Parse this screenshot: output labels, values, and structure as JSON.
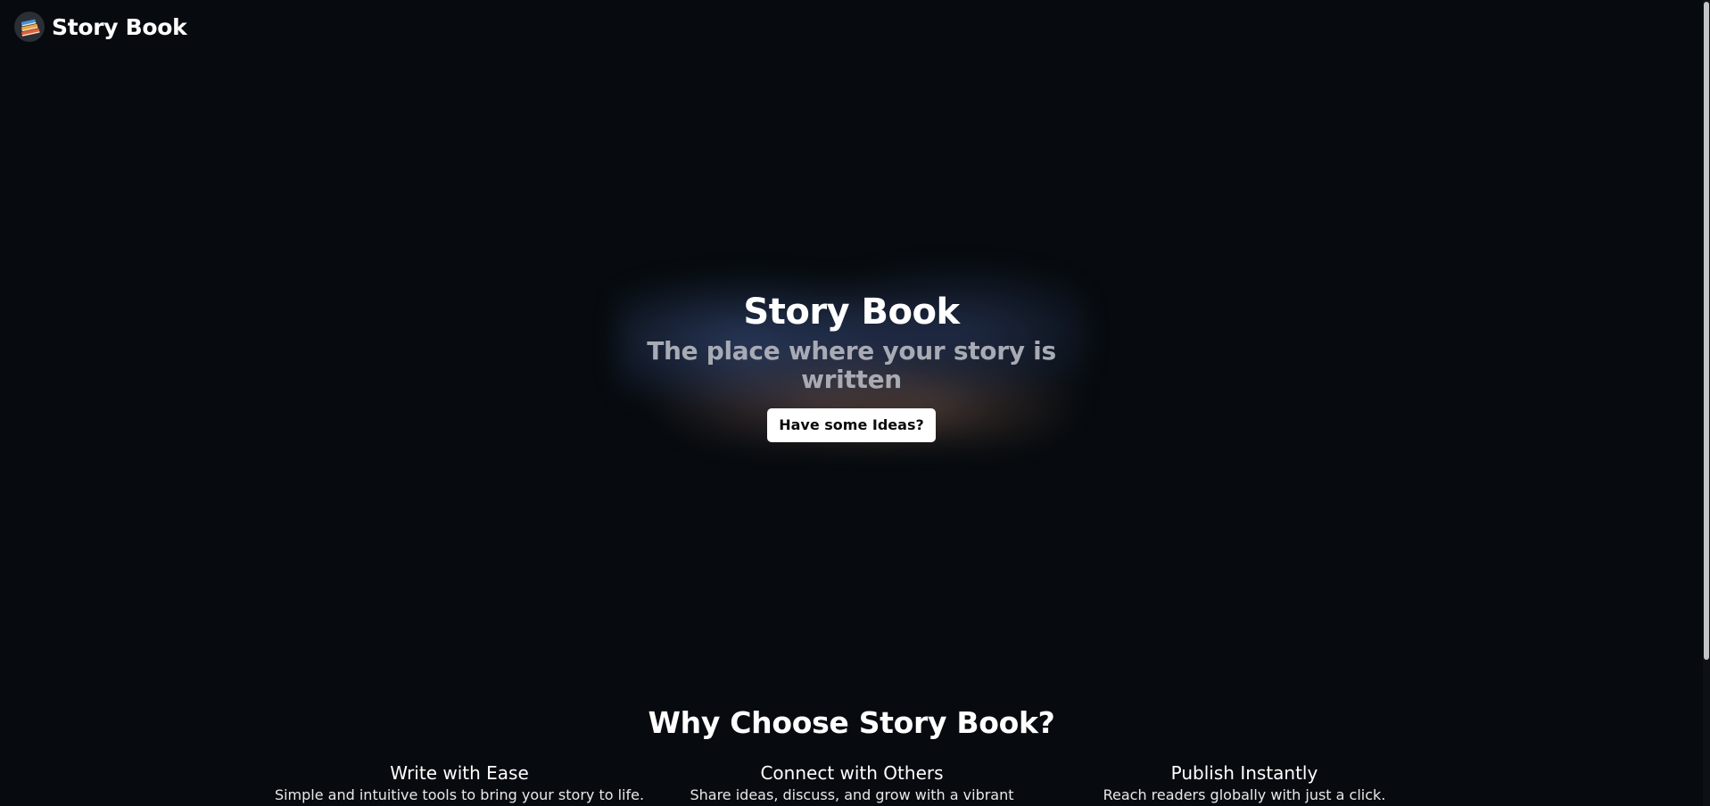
{
  "header": {
    "logo_icon": "stack-of-books-icon",
    "brand": "Story Book"
  },
  "hero": {
    "title": "Story Book",
    "subtitle": "The place where your story is written",
    "cta_label": "Have some Ideas?"
  },
  "features": {
    "heading": "Why Choose Story Book?",
    "items": [
      {
        "title": "Write with Ease",
        "text": "Simple and intuitive tools to bring your story to life."
      },
      {
        "title": "Connect with Others",
        "text": "Share ideas, discuss, and grow with a vibrant"
      },
      {
        "title": "Publish Instantly",
        "text": "Reach readers globally with just a click."
      }
    ]
  },
  "colors": {
    "background": "#070b0f",
    "text": "#ffffff",
    "subtitle": "#a8abb4",
    "button_bg": "#ffffff",
    "button_text": "#0b0b0b"
  }
}
